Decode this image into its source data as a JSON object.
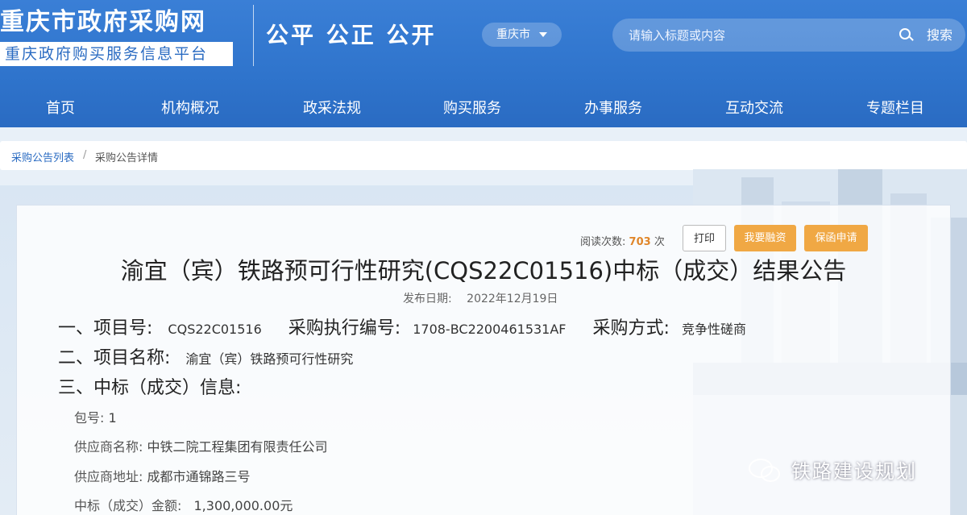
{
  "header": {
    "site_title": "重庆市政府采购网",
    "site_subtitle": "重庆政府购买服务信息平台",
    "slogan": "公平 公正 公开",
    "city": "重庆市",
    "search_placeholder": "请输入标题或内容",
    "search_label": "搜索"
  },
  "nav": [
    "首页",
    "机构概况",
    "政采法规",
    "购买服务",
    "办事服务",
    "互动交流",
    "专题栏目"
  ],
  "breadcrumb": {
    "list": "采购公告列表",
    "sep": "/",
    "current": "采购公告详情"
  },
  "toolbar": {
    "read_label": "阅读次数:",
    "read_count": "703",
    "read_unit": "次",
    "print": "打印",
    "finance": "我要融资",
    "guarantee": "保函申请"
  },
  "doc": {
    "title": "渝宜（宾）铁路预可行性研究(CQS22C01516)中标（成交）结果公告",
    "date_label": "发布日期:",
    "date": "2022年12月19日",
    "s1_label": "一、项目号:",
    "s1_value": "CQS22C01516",
    "exec_label": "采购执行编号:",
    "exec_value": "1708-BC2200461531AF",
    "method_label": "采购方式:",
    "method_value": "竞争性磋商",
    "s2_label": "二、项目名称:",
    "s2_value": "渝宜（宾）铁路预可行性研究",
    "s3_label": "三、中标（成交）信息:",
    "package_label": "包号:",
    "package_value": "1",
    "supplier_label": "供应商名称:",
    "supplier_value": "中铁二院工程集团有限责任公司",
    "address_label": "供应商地址:",
    "address_value": "成都市通锦路三号",
    "amount_label": "中标（成交）金额:",
    "amount_value": "1,300,000.00元"
  },
  "watermark": "铁路建设规划"
}
